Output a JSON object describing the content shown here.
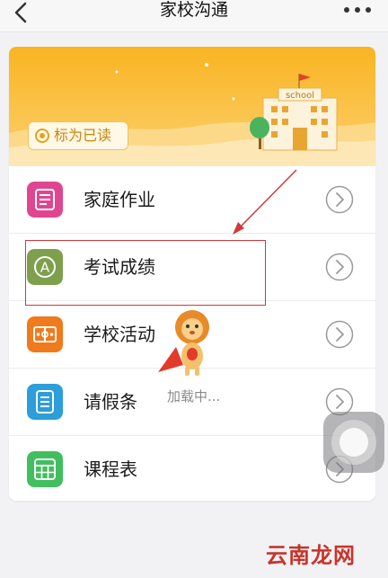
{
  "navbar": {
    "title": "家校沟通",
    "back_icon": "chevron-left-icon",
    "more_icon": "more-dots-icon"
  },
  "banner": {
    "mark_read_label": "标为已读",
    "school_sign": "school",
    "colors": {
      "sky": "#f8ba2e",
      "ground": "#fde6ab"
    }
  },
  "menu": {
    "items": [
      {
        "label": "家庭作业",
        "icon": "homework-doc-icon",
        "color": "#e0468f"
      },
      {
        "label": "考试成绩",
        "icon": "grade-a-icon",
        "color": "#7ea04c"
      },
      {
        "label": "学校活动",
        "icon": "activity-field-icon",
        "color": "#f07a1c"
      },
      {
        "label": "请假条",
        "icon": "leave-note-icon",
        "color": "#2c9ed9"
      },
      {
        "label": "课程表",
        "icon": "timetable-grid-icon",
        "color": "#41bf5e"
      }
    ]
  },
  "loading": {
    "text": "加载中..."
  },
  "watermark": {
    "text": "云南龙网"
  },
  "annotation": {
    "color": "#cf3a3a"
  }
}
